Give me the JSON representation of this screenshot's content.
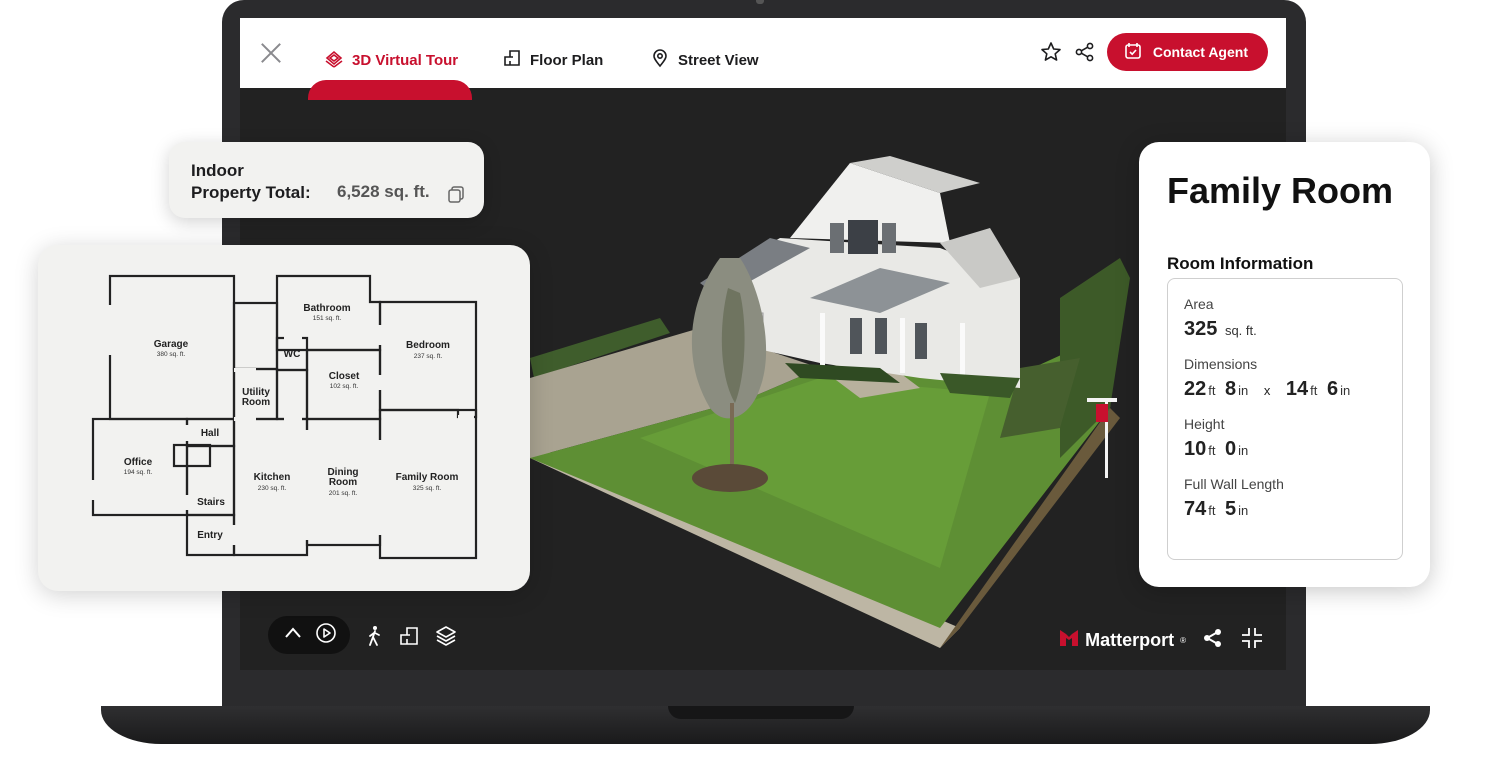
{
  "topbar": {
    "tabs": [
      {
        "label": "3D Virtual Tour",
        "icon": "cube-icon",
        "active": true
      },
      {
        "label": "Floor Plan",
        "icon": "floorplan-icon",
        "active": false
      },
      {
        "label": "Street View",
        "icon": "location-pin-icon",
        "active": false
      }
    ],
    "contact_label": "Contact Agent"
  },
  "total": {
    "label_line1": "Indoor",
    "label_line2": "Property Total:",
    "value": "6,528 sq. ft."
  },
  "floorplan": {
    "rooms": [
      {
        "name": "Garage",
        "size": "380 sq. ft."
      },
      {
        "name": "Bathroom",
        "size": "151 sq. ft."
      },
      {
        "name": "Bedroom",
        "size": "237 sq. ft."
      },
      {
        "name": "WC",
        "size": ""
      },
      {
        "name": "Closet",
        "size": "102 sq. ft."
      },
      {
        "name": "Utility",
        "size": ""
      },
      {
        "name": "Room",
        "size": ""
      },
      {
        "name": "Hall",
        "size": ""
      },
      {
        "name": "Office",
        "size": "194 sq. ft."
      },
      {
        "name": "Kitchen",
        "size": "230 sq. ft."
      },
      {
        "name": "Dining",
        "size": ""
      },
      {
        "name": "Room",
        "size": "201 sq. ft."
      },
      {
        "name": "Family Room",
        "size": "325 sq. ft."
      },
      {
        "name": "Stairs",
        "size": ""
      },
      {
        "name": "Entry",
        "size": ""
      }
    ]
  },
  "room_info": {
    "title": "Family Room",
    "subtitle": "Room Information",
    "area_label": "Area",
    "area_value": "325",
    "area_unit": "sq. ft.",
    "dimensions_label": "Dimensions",
    "dim_w_ft": "22",
    "dim_w_in": "8",
    "dim_sep": "x",
    "dim_l_ft": "14",
    "dim_l_in": "6",
    "height_label": "Height",
    "height_ft": "10",
    "height_in": "0",
    "wall_label": "Full Wall Length",
    "wall_ft": "74",
    "wall_in": "5",
    "ft_unit": "ft",
    "in_unit": "in"
  },
  "brand": {
    "name": "Matterport",
    "mark": "®",
    "color": "#c8102e"
  }
}
